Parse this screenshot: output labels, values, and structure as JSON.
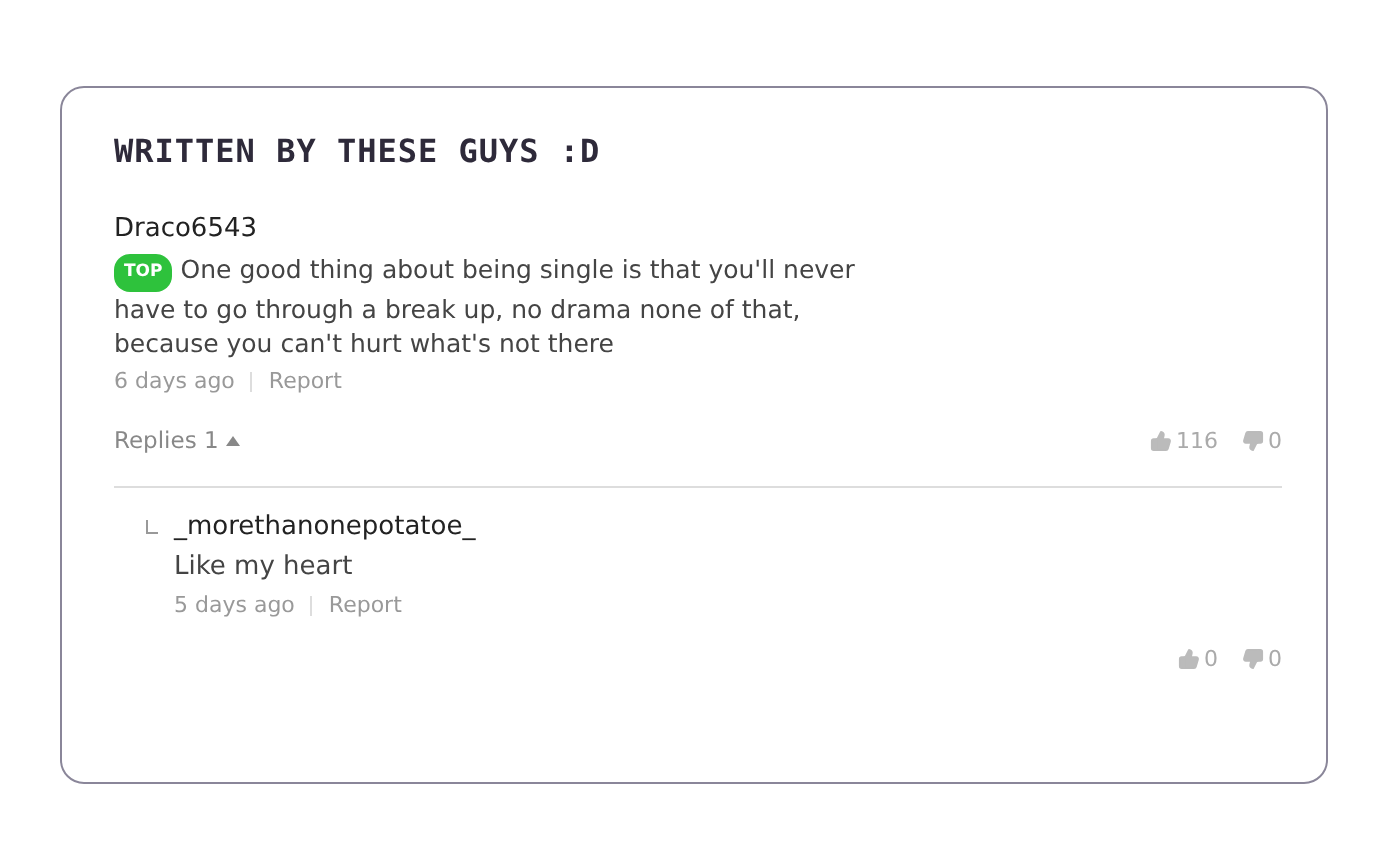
{
  "title": "WRITTEN BY THESE GUYS :D",
  "comment": {
    "author": "Draco6543",
    "badge": "TOP",
    "text": "One good thing about being single is that you'll never have to go through a break up, no drama none of that, because you can't hurt what's not there",
    "time": "6 days ago",
    "report": "Report",
    "replies_label": "Replies 1",
    "replies_expanded": true,
    "likes": "116",
    "dislikes": "0"
  },
  "replies": [
    {
      "author": "_morethanonepotatoe_",
      "text": "Like my heart",
      "time": "5 days ago",
      "report": "Report",
      "likes": "0",
      "dislikes": "0"
    }
  ]
}
